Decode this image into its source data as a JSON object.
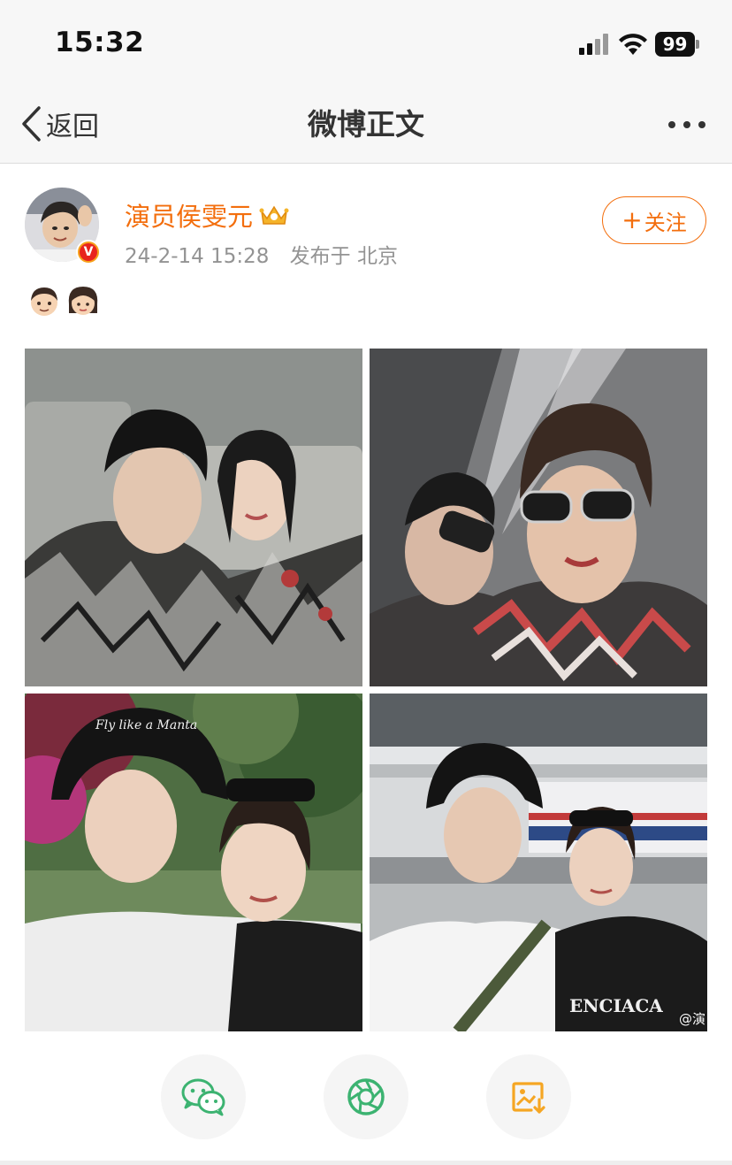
{
  "status_bar": {
    "time": "15:32",
    "battery": "99"
  },
  "nav": {
    "back_label": "返回",
    "title": "微博正文"
  },
  "post": {
    "author": "演员侯雯元",
    "time": "24-2-14 15:28",
    "location": "发布于 北京",
    "follow_label": "关注",
    "verified_mark": "V",
    "emojis": [
      "boy-emoji",
      "girl-emoji"
    ],
    "photo_captions": [
      "Fly like a Manta",
      "ENCIACA"
    ],
    "watermark": "@演"
  },
  "actions": [
    "wechat-share",
    "moments-share",
    "save-image"
  ],
  "colors": {
    "accent": "#f36e0d",
    "wechat": "#3cb371",
    "download": "#f5a623"
  }
}
